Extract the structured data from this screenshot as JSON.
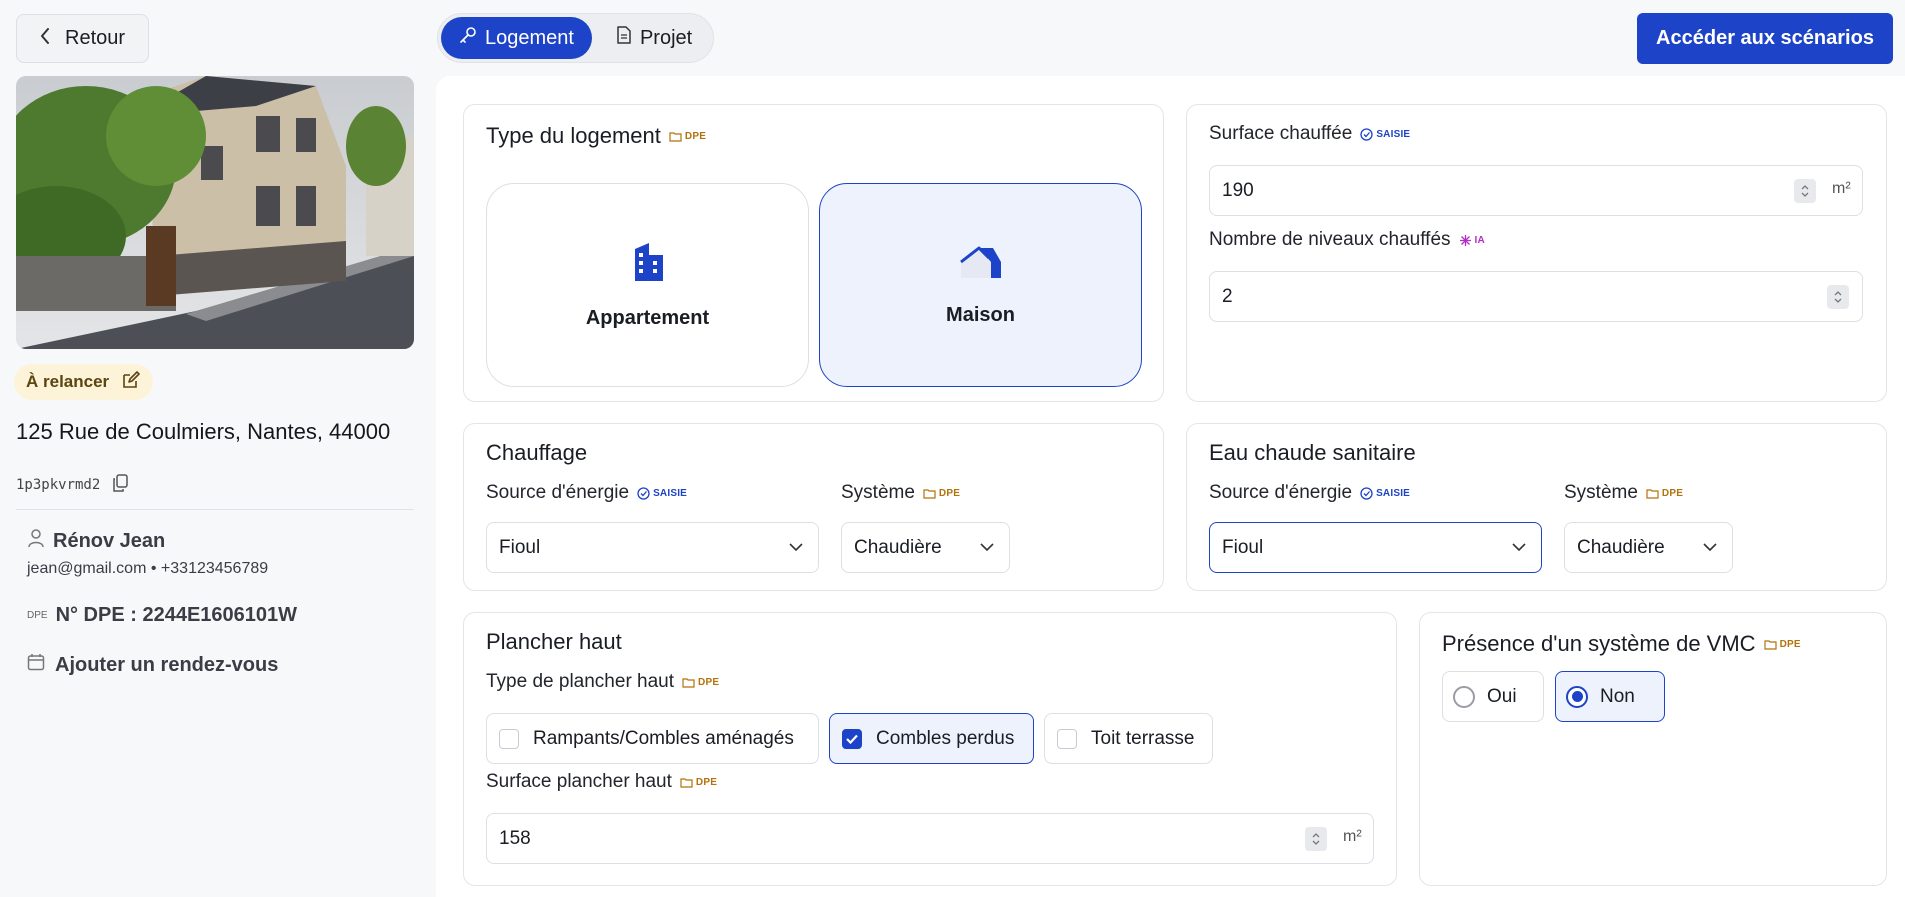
{
  "sidebar": {
    "back_label": "Retour",
    "status": "À relancer",
    "address": "125 Rue de Coulmiers, Nantes, 44000",
    "reference": "1p3pkvrmd2",
    "contact_name": "Rénov Jean",
    "contact_email": "jean@gmail.com",
    "contact_sep": "•",
    "contact_phone": "+33123456789",
    "dpe_tiny": "DPE",
    "dpe_number": "N° DPE : 2244E1606101W",
    "add_rdv": "Ajouter un rendez-vous"
  },
  "tabs": [
    {
      "label": "Logement",
      "icon": "key-icon",
      "active": true
    },
    {
      "label": "Projet",
      "icon": "document-icon",
      "active": false
    }
  ],
  "cta_label": "Accéder aux scénarios",
  "badges": {
    "dpe": "DPE",
    "saisie": "SAISIE",
    "ia": "IA"
  },
  "type_logement": {
    "title": "Type du logement",
    "options": [
      {
        "label": "Appartement",
        "icon": "building-icon",
        "selected": false
      },
      {
        "label": "Maison",
        "icon": "house-icon",
        "selected": true
      }
    ]
  },
  "surface": {
    "label": "Surface chauffée",
    "value": "190",
    "unit": "m²",
    "niveaux_label": "Nombre de niveaux chauffés",
    "niveaux_value": "2"
  },
  "chauffage": {
    "title": "Chauffage",
    "source_label": "Source d'énergie",
    "source_value": "Fioul",
    "systeme_label": "Système",
    "systeme_value": "Chaudière"
  },
  "ecs": {
    "title": "Eau chaude sanitaire",
    "source_label": "Source d'énergie",
    "source_value": "Fioul",
    "systeme_label": "Système",
    "systeme_value": "Chaudière"
  },
  "plancher": {
    "title": "Plancher haut",
    "type_label": "Type de plancher haut",
    "options": [
      {
        "label": "Rampants/Combles aménagés",
        "checked": false
      },
      {
        "label": "Combles perdus",
        "checked": true
      },
      {
        "label": "Toit terrasse",
        "checked": false
      }
    ],
    "surface_label": "Surface plancher haut",
    "surface_value": "158",
    "unit": "m²"
  },
  "vmc": {
    "title": "Présence d'un système de VMC",
    "options": [
      {
        "label": "Oui",
        "selected": false
      },
      {
        "label": "Non",
        "selected": true
      }
    ]
  },
  "colors": {
    "accent": "#1d44c8",
    "dpe": "#b3720b",
    "ia": "#b12fc4",
    "status_bg": "#fdf3d8"
  }
}
